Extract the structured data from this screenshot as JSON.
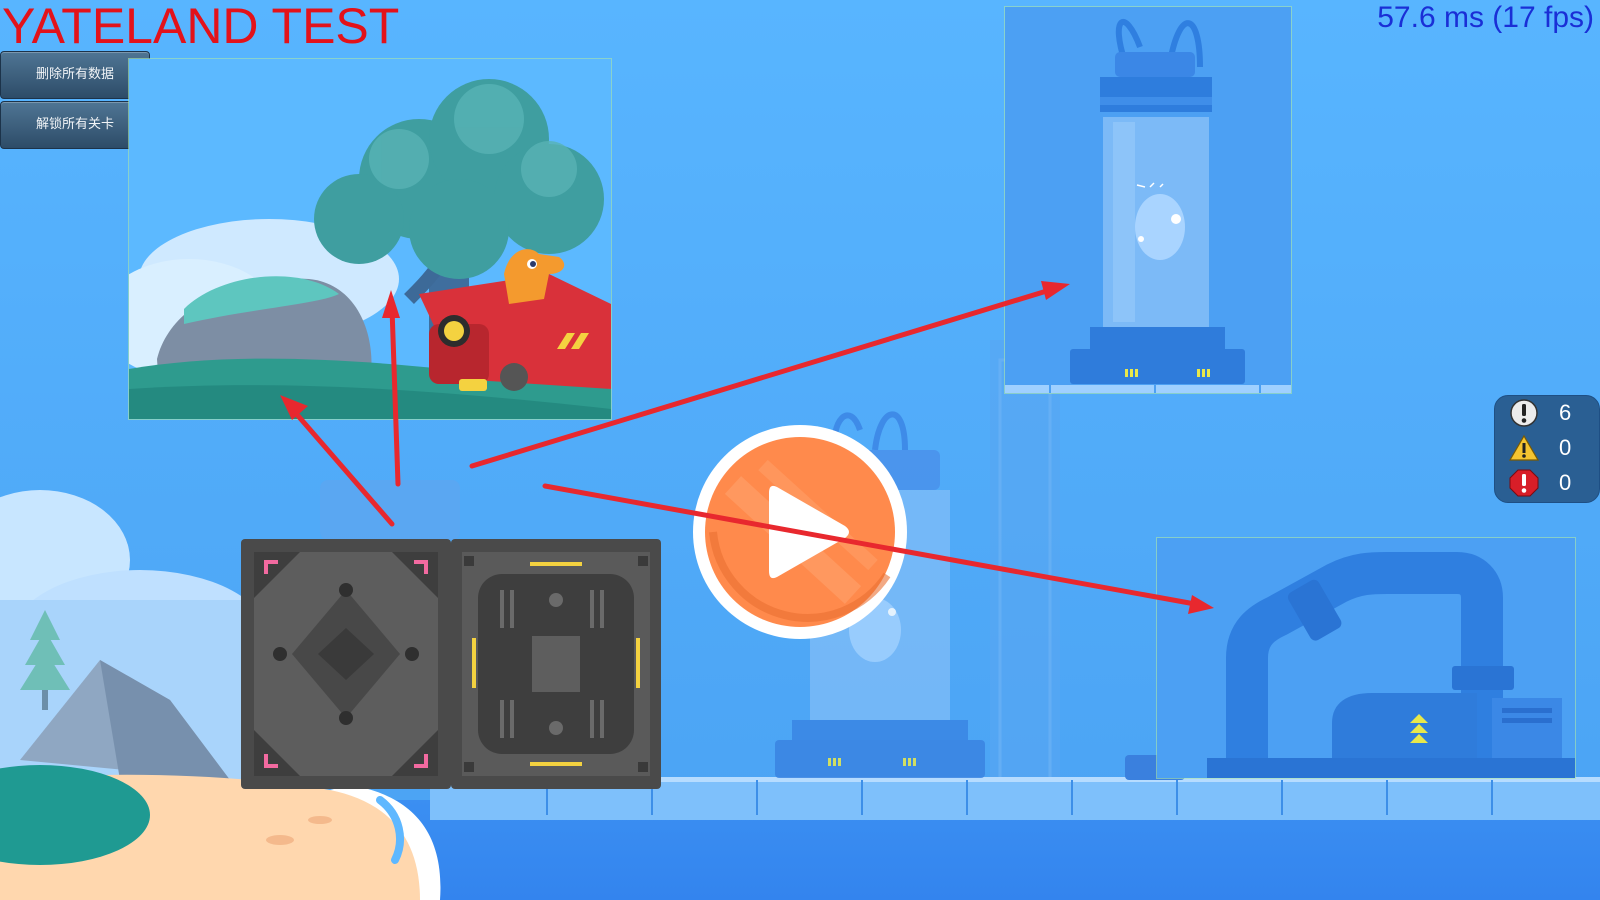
{
  "debug_title": "YATELAND TEST",
  "fps_readout": "57.6 ms (17 fps)",
  "debug_buttons": [
    {
      "label": "删除所有数据"
    },
    {
      "label": "解锁所有关卡"
    }
  ],
  "console_counts": {
    "info": "6",
    "warning": "0",
    "error": "0"
  },
  "colors": {
    "title_red": "#e3121a",
    "fps_blue": "#1a2fd6",
    "play_orange": "#ff8a4c",
    "arrow_red": "#e8282e"
  },
  "icons": [
    "play-icon",
    "info-icon",
    "warning-icon",
    "error-icon"
  ]
}
